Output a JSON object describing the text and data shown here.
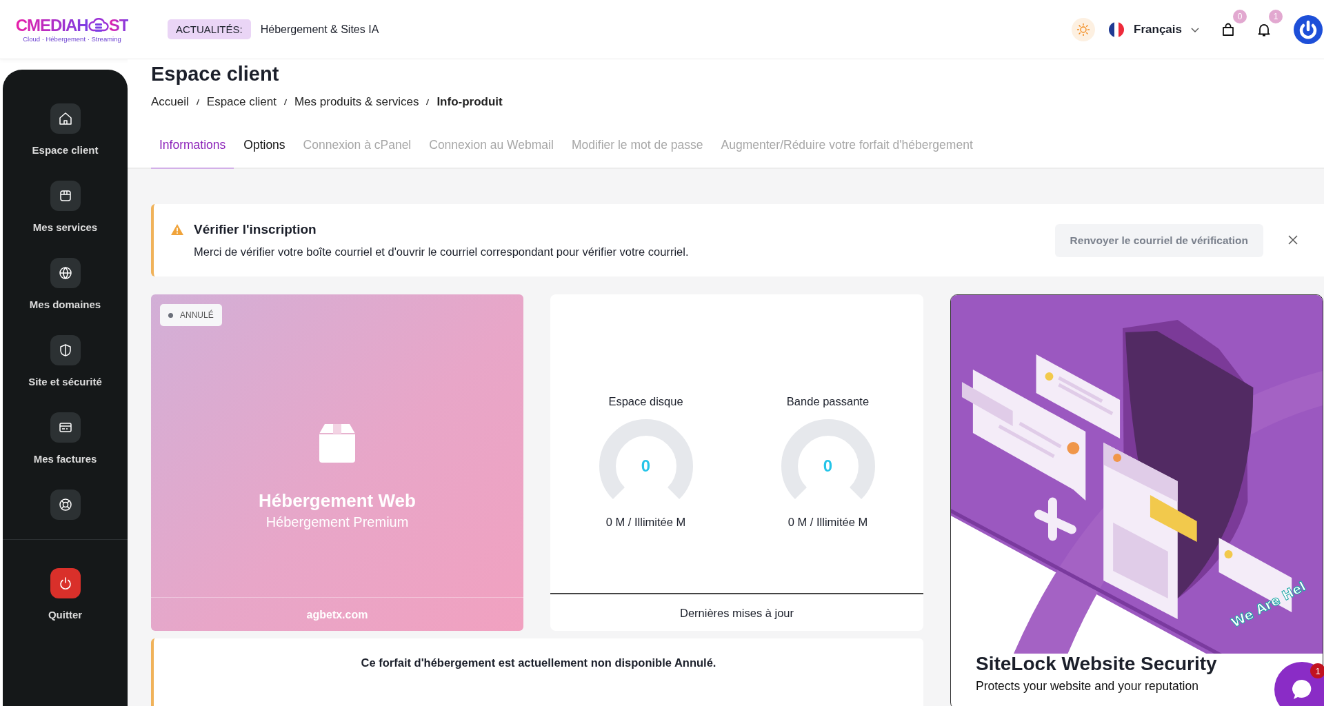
{
  "header": {
    "logo": {
      "name_start": "CMEDIAH",
      "name_end": "ST",
      "tagline": "Cloud · Hébergement · Streaming"
    },
    "news": {
      "label": "ACTUALITÉS:",
      "text": "Hébergement & Sites IA"
    },
    "language": "Français",
    "cart_count": "0",
    "notification_count": "1"
  },
  "sidebar": {
    "items": [
      {
        "label": "Espace client"
      },
      {
        "label": "Mes services"
      },
      {
        "label": "Mes domaines"
      },
      {
        "label": "Site et sécurité"
      },
      {
        "label": "Mes factures"
      }
    ],
    "help_shortcut": true,
    "quit": "Quitter"
  },
  "page": {
    "title": "Espace client",
    "breadcrumb": [
      {
        "label": "Accueil",
        "current": false
      },
      {
        "label": "Espace client",
        "current": false
      },
      {
        "label": "Mes produits & services",
        "current": false
      },
      {
        "label": "Info-produit",
        "current": true
      }
    ]
  },
  "tabs": [
    {
      "label": "Informations",
      "selected": true,
      "disabled": false
    },
    {
      "label": "Options",
      "selected": false,
      "disabled": false
    },
    {
      "label": "Connexion à cPanel",
      "selected": false,
      "disabled": true
    },
    {
      "label": "Connexion au Webmail",
      "selected": false,
      "disabled": true
    },
    {
      "label": "Modifier le mot de passe",
      "selected": false,
      "disabled": true
    },
    {
      "label": "Augmenter/Réduire votre forfait d'hébergement",
      "selected": false,
      "disabled": true
    }
  ],
  "alert": {
    "title": "Vérifier l'inscription",
    "message": "Merci de vérifier votre boîte courriel et d'ouvrir le courriel correspondant pour vérifier votre courriel.",
    "button": "Renvoyer le courriel de vérification"
  },
  "product": {
    "status": "ANNULÉ",
    "name": "Hébergement Web",
    "plan": "Hébergement Premium",
    "domain": "agbetx.com"
  },
  "usage": {
    "meters": [
      {
        "label": "Espace disque",
        "value": "0",
        "reading": "0 M / Illimitée M"
      },
      {
        "label": "Bande passante",
        "value": "0",
        "reading": "0 M / Illimitée M"
      }
    ],
    "footer": "Dernières mises à jour"
  },
  "notice": "Ce forfait d'hébergement est actuellement non disponible Annulé.",
  "promo": {
    "title": "SiteLock Website Security",
    "subtitle": "Protects your website and your reputation"
  },
  "chat": {
    "greeting": "We Are Hel",
    "unread": "1"
  }
}
